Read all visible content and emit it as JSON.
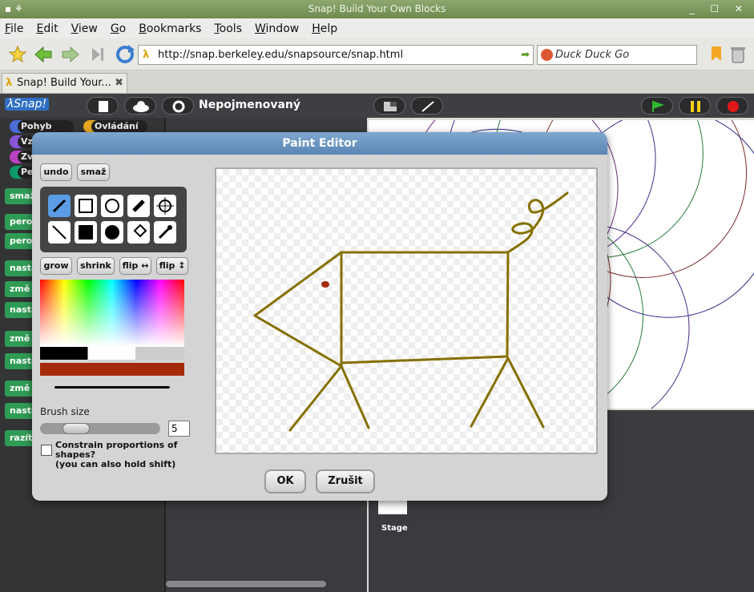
{
  "window": {
    "title": "Snap! Build Your Own Blocks",
    "controls": "_ ☐ ✕"
  },
  "menu": [
    "File",
    "Edit",
    "View",
    "Go",
    "Bookmarks",
    "Tools",
    "Window",
    "Help"
  ],
  "nav": {
    "url": "http://snap.berkeley.edu/snapsource/snap.html",
    "search_placeholder": "Duck Duck Go"
  },
  "tab": {
    "label": "Snap! Build Your..."
  },
  "snap": {
    "logo": "λSnap!",
    "project_name": "Nepojmenovaný"
  },
  "categories": [
    {
      "label": "Pohyb",
      "color": "#4a6cd4"
    },
    {
      "label": "Ovládání",
      "color": "#e6a822"
    },
    {
      "label": "Vz",
      "color": "#8a55d7"
    },
    {
      "label": "Zv",
      "color": "#bb42c3"
    },
    {
      "label": "Pe",
      "color": "#0e9a6c"
    }
  ],
  "blocks": [
    "smaž",
    "pero",
    "pero",
    "nasta",
    "změ",
    "nasta",
    "změ",
    "nasta",
    "změ",
    "nasta",
    "razítk"
  ],
  "stage_label": "Stage",
  "dialog": {
    "title": "Paint Editor",
    "undo": "undo",
    "clear": "smaž",
    "grow": "grow",
    "shrink": "shrink",
    "flip_h": "flip ↔",
    "flip_v": "flip ↕",
    "brush_size_label": "Brush size",
    "brush_size": "5",
    "constrain_label": "Constrain proportions of shapes?",
    "constrain_hint": "(you can also hold shift)",
    "ok": "OK",
    "cancel": "Zrušit",
    "current_color": "#a52a0a",
    "stroke_color": "#857000"
  }
}
